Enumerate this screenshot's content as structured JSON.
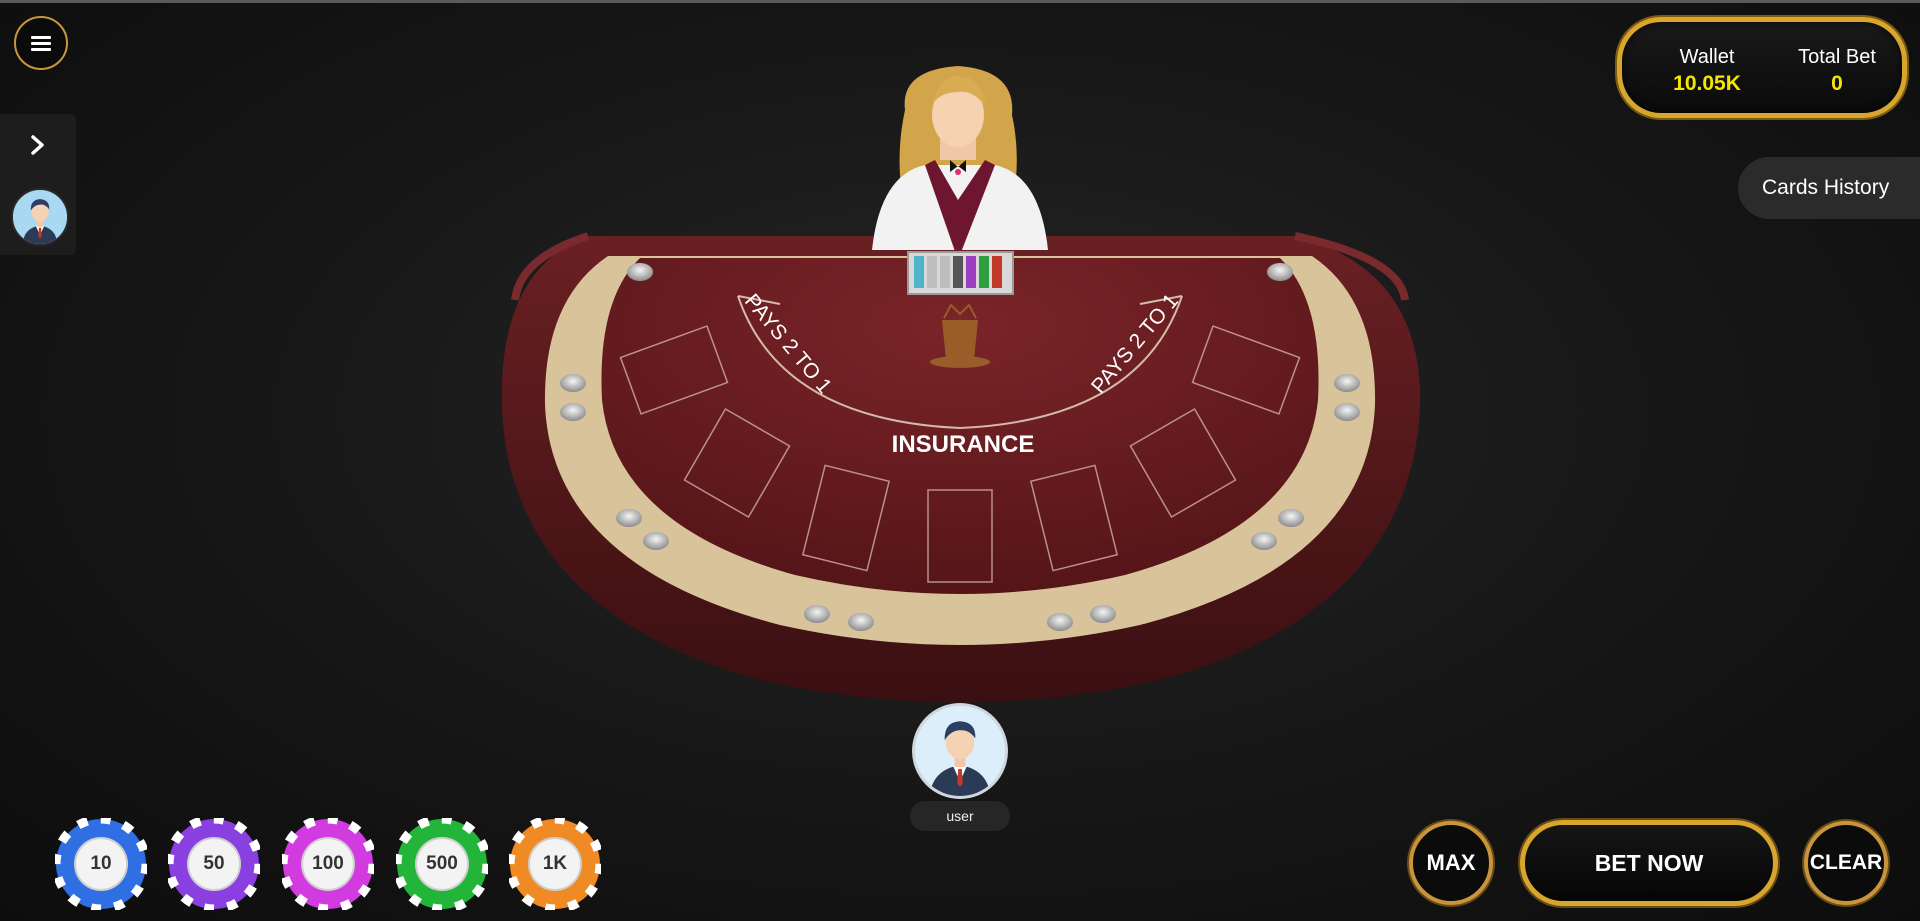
{
  "menu": {
    "icon": "hamburger-icon"
  },
  "side_panel": {
    "expand_icon": "chevron-right-icon",
    "avatar_icon": "player-avatar-icon"
  },
  "wallet": {
    "wallet_label": "Wallet",
    "wallet_value": "10.05K",
    "total_bet_label": "Total Bet",
    "total_bet_value": "0",
    "value_color": "#f5e600",
    "border_color": "#d9a62d"
  },
  "cards_history": {
    "label": "Cards History"
  },
  "table": {
    "left_label": "PAYS 2 TO 1",
    "right_label": "PAYS 2 TO 1",
    "center_label": "INSURANCE",
    "felt_color": "#6b1f22",
    "rail_color": "#5a1a1c",
    "trim_color": "#d9c39a"
  },
  "player": {
    "name": "user"
  },
  "chips": [
    {
      "label": "10",
      "color": "#2f6fe3"
    },
    {
      "label": "50",
      "color": "#8a3fe0"
    },
    {
      "label": "100",
      "color": "#d23be0"
    },
    {
      "label": "500",
      "color": "#23b53a"
    },
    {
      "label": "1K",
      "color": "#f08a24"
    }
  ],
  "actions": {
    "max_label": "MAX",
    "bet_now_label": "BET NOW",
    "clear_label": "CLEAR"
  }
}
